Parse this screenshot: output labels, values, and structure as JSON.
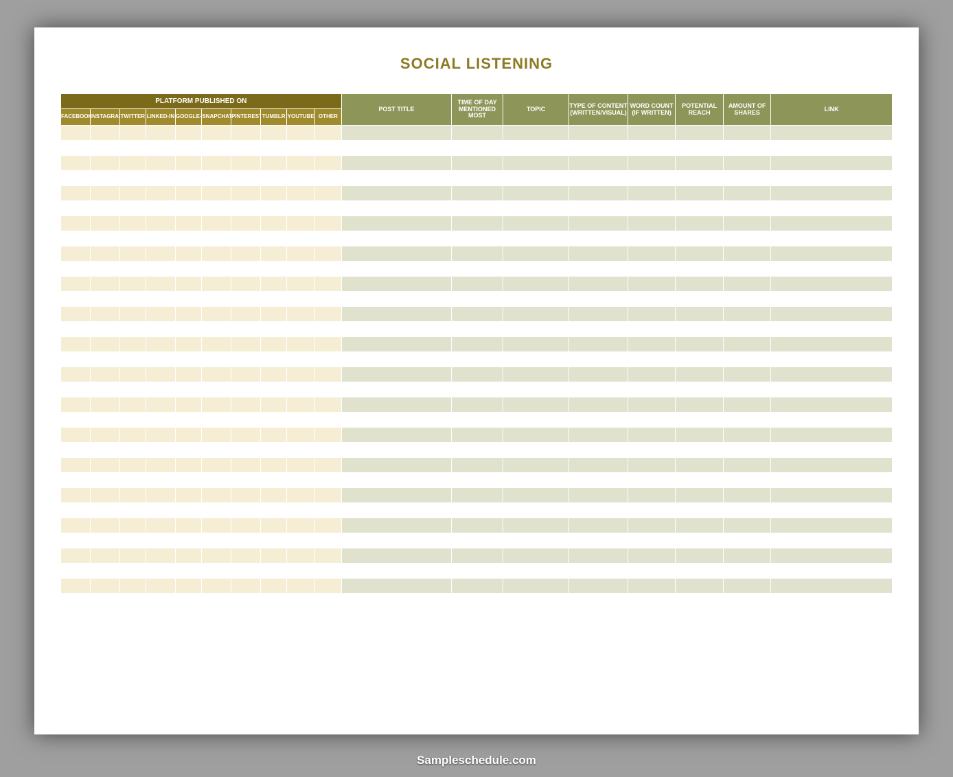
{
  "title": "SOCIAL LISTENING",
  "platform_header": "PLATFORM PUBLISHED ON",
  "platform_columns": [
    "FACEBOOK",
    "INSTAGRAM",
    "TWITTER",
    "LINKED-IN",
    "GOOGLE+",
    "SNAPCHAT",
    "PINTEREST",
    "TUMBLR",
    "YOUTUBE",
    "OTHER"
  ],
  "right_columns": [
    "POST TITLE",
    "TIME OF DAY MENTIONED MOST",
    "TOPIC",
    "TYPE OF CONTENT (WRITTEN/VISUAL)",
    "WORD COUNT (IF WRITTEN)",
    "POTENTIAL REACH",
    "AMOUNT OF SHARES",
    "LINK"
  ],
  "row_count": 32,
  "footer": "Sampleschedule.com"
}
